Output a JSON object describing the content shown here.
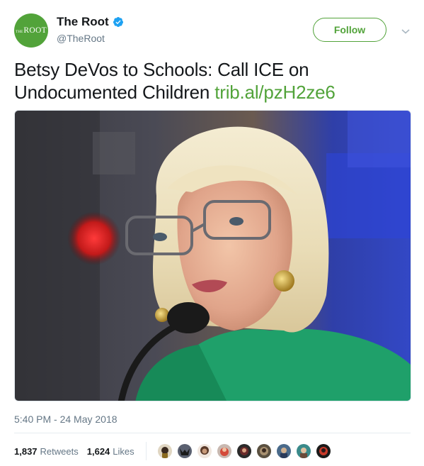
{
  "account": {
    "display_name": "The Root",
    "handle": "@TheRoot",
    "avatar_logo_small": "THE",
    "avatar_logo_large": "ROOT",
    "verified": true,
    "verified_icon": "verified-badge-icon",
    "brand_color": "#52a33a"
  },
  "actions": {
    "follow_label": "Follow",
    "menu_icon": "chevron-down-icon"
  },
  "tweet": {
    "text": "Betsy DeVos to Schools: Call ICE on Undocumented Children",
    "link_text": "trib.al/pzH2ze6",
    "timestamp": "5:40 PM - 24 May 2018"
  },
  "stats": {
    "retweets_count": "1,837",
    "retweets_label": "Retweets",
    "likes_count": "1,624",
    "likes_label": "Likes"
  },
  "colors": {
    "link": "#52a33a",
    "secondary_text": "#657786",
    "primary_text": "#14171a"
  }
}
